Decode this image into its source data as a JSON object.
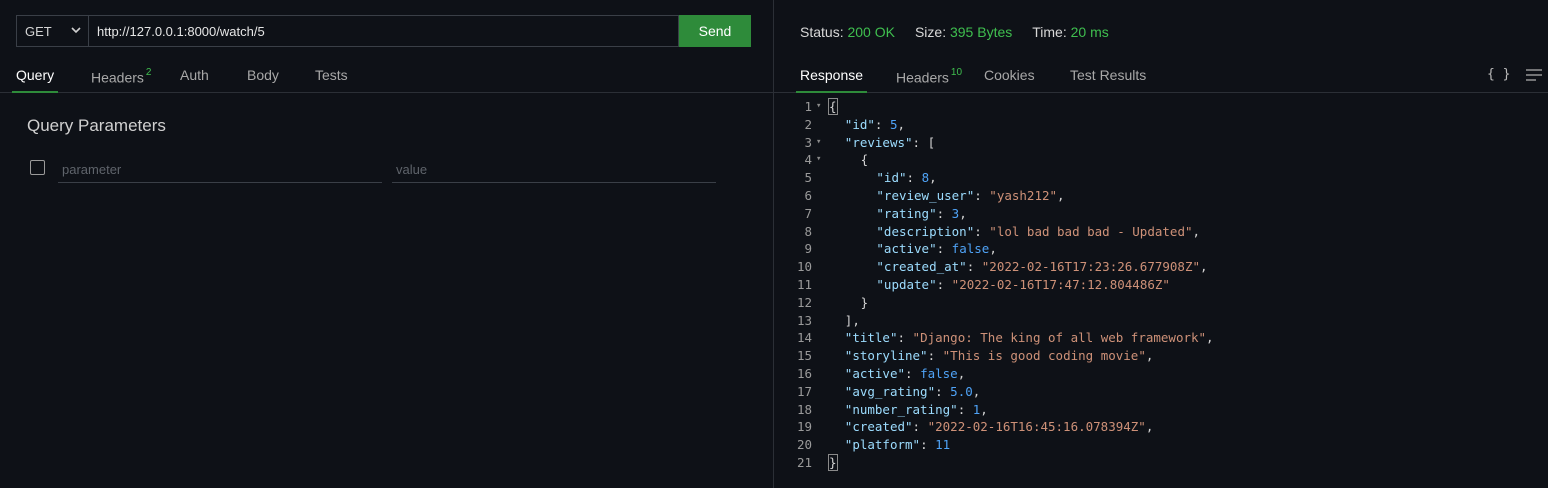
{
  "request": {
    "method": "GET",
    "url": "http://127.0.0.1:8000/watch/5",
    "send_label": "Send"
  },
  "request_tabs": [
    {
      "label": "Query",
      "badge": ""
    },
    {
      "label": "Headers",
      "badge": "2"
    },
    {
      "label": "Auth",
      "badge": ""
    },
    {
      "label": "Body",
      "badge": ""
    },
    {
      "label": "Tests",
      "badge": ""
    }
  ],
  "query": {
    "title": "Query Parameters",
    "param_placeholder": "parameter",
    "value_placeholder": "value"
  },
  "status": {
    "status_label": "Status:",
    "status_value": "200 OK",
    "size_label": "Size:",
    "size_value": "395 Bytes",
    "time_label": "Time:",
    "time_value": "20 ms"
  },
  "response_tabs": [
    {
      "label": "Response",
      "badge": ""
    },
    {
      "label": "Headers",
      "badge": "10"
    },
    {
      "label": "Cookies",
      "badge": ""
    },
    {
      "label": "Test Results",
      "badge": ""
    }
  ],
  "format_icon": "{ }",
  "colors": {
    "accent": "#2e8b3a",
    "status_green": "#3fbf4f",
    "json_key": "#9cdcfe",
    "json_string": "#ce9178",
    "json_number": "#4fa3f7"
  },
  "response_lines": [
    {
      "n": "1",
      "fold": true,
      "indent": 0,
      "tokens": [
        {
          "t": "p",
          "v": "{"
        }
      ]
    },
    {
      "n": "2",
      "fold": false,
      "indent": 1,
      "tokens": [
        {
          "t": "k",
          "v": "\"id\""
        },
        {
          "t": "p",
          "v": ": "
        },
        {
          "t": "n",
          "v": "5"
        },
        {
          "t": "p",
          "v": ","
        }
      ]
    },
    {
      "n": "3",
      "fold": true,
      "indent": 1,
      "tokens": [
        {
          "t": "k",
          "v": "\"reviews\""
        },
        {
          "t": "p",
          "v": ": ["
        }
      ]
    },
    {
      "n": "4",
      "fold": true,
      "indent": 2,
      "tokens": [
        {
          "t": "p",
          "v": "{"
        }
      ]
    },
    {
      "n": "5",
      "fold": false,
      "indent": 3,
      "tokens": [
        {
          "t": "k",
          "v": "\"id\""
        },
        {
          "t": "p",
          "v": ": "
        },
        {
          "t": "n",
          "v": "8"
        },
        {
          "t": "p",
          "v": ","
        }
      ]
    },
    {
      "n": "6",
      "fold": false,
      "indent": 3,
      "tokens": [
        {
          "t": "k",
          "v": "\"review_user\""
        },
        {
          "t": "p",
          "v": ": "
        },
        {
          "t": "s",
          "v": "\"yash212\""
        },
        {
          "t": "p",
          "v": ","
        }
      ]
    },
    {
      "n": "7",
      "fold": false,
      "indent": 3,
      "tokens": [
        {
          "t": "k",
          "v": "\"rating\""
        },
        {
          "t": "p",
          "v": ": "
        },
        {
          "t": "n",
          "v": "3"
        },
        {
          "t": "p",
          "v": ","
        }
      ]
    },
    {
      "n": "8",
      "fold": false,
      "indent": 3,
      "tokens": [
        {
          "t": "k",
          "v": "\"description\""
        },
        {
          "t": "p",
          "v": ": "
        },
        {
          "t": "s",
          "v": "\"lol bad bad bad - Updated\""
        },
        {
          "t": "p",
          "v": ","
        }
      ]
    },
    {
      "n": "9",
      "fold": false,
      "indent": 3,
      "tokens": [
        {
          "t": "k",
          "v": "\"active\""
        },
        {
          "t": "p",
          "v": ": "
        },
        {
          "t": "b",
          "v": "false"
        },
        {
          "t": "p",
          "v": ","
        }
      ]
    },
    {
      "n": "10",
      "fold": false,
      "indent": 3,
      "tokens": [
        {
          "t": "k",
          "v": "\"created_at\""
        },
        {
          "t": "p",
          "v": ": "
        },
        {
          "t": "s",
          "v": "\"2022-02-16T17:23:26.677908Z\""
        },
        {
          "t": "p",
          "v": ","
        }
      ]
    },
    {
      "n": "11",
      "fold": false,
      "indent": 3,
      "tokens": [
        {
          "t": "k",
          "v": "\"update\""
        },
        {
          "t": "p",
          "v": ": "
        },
        {
          "t": "s",
          "v": "\"2022-02-16T17:47:12.804486Z\""
        }
      ]
    },
    {
      "n": "12",
      "fold": false,
      "indent": 2,
      "tokens": [
        {
          "t": "p",
          "v": "}"
        }
      ]
    },
    {
      "n": "13",
      "fold": false,
      "indent": 1,
      "tokens": [
        {
          "t": "p",
          "v": "],"
        }
      ]
    },
    {
      "n": "14",
      "fold": false,
      "indent": 1,
      "tokens": [
        {
          "t": "k",
          "v": "\"title\""
        },
        {
          "t": "p",
          "v": ": "
        },
        {
          "t": "s",
          "v": "\"Django: The king of all web framework\""
        },
        {
          "t": "p",
          "v": ","
        }
      ]
    },
    {
      "n": "15",
      "fold": false,
      "indent": 1,
      "tokens": [
        {
          "t": "k",
          "v": "\"storyline\""
        },
        {
          "t": "p",
          "v": ": "
        },
        {
          "t": "s",
          "v": "\"This is good coding movie\""
        },
        {
          "t": "p",
          "v": ","
        }
      ]
    },
    {
      "n": "16",
      "fold": false,
      "indent": 1,
      "tokens": [
        {
          "t": "k",
          "v": "\"active\""
        },
        {
          "t": "p",
          "v": ": "
        },
        {
          "t": "b",
          "v": "false"
        },
        {
          "t": "p",
          "v": ","
        }
      ]
    },
    {
      "n": "17",
      "fold": false,
      "indent": 1,
      "tokens": [
        {
          "t": "k",
          "v": "\"avg_rating\""
        },
        {
          "t": "p",
          "v": ": "
        },
        {
          "t": "n",
          "v": "5.0"
        },
        {
          "t": "p",
          "v": ","
        }
      ]
    },
    {
      "n": "18",
      "fold": false,
      "indent": 1,
      "tokens": [
        {
          "t": "k",
          "v": "\"number_rating\""
        },
        {
          "t": "p",
          "v": ": "
        },
        {
          "t": "n",
          "v": "1"
        },
        {
          "t": "p",
          "v": ","
        }
      ]
    },
    {
      "n": "19",
      "fold": false,
      "indent": 1,
      "tokens": [
        {
          "t": "k",
          "v": "\"created\""
        },
        {
          "t": "p",
          "v": ": "
        },
        {
          "t": "s",
          "v": "\"2022-02-16T16:45:16.078394Z\""
        },
        {
          "t": "p",
          "v": ","
        }
      ]
    },
    {
      "n": "20",
      "fold": false,
      "indent": 1,
      "tokens": [
        {
          "t": "k",
          "v": "\"platform\""
        },
        {
          "t": "p",
          "v": ": "
        },
        {
          "t": "n",
          "v": "11"
        }
      ]
    },
    {
      "n": "21",
      "fold": false,
      "indent": 0,
      "tokens": [
        {
          "t": "p",
          "v": "}"
        }
      ]
    }
  ]
}
